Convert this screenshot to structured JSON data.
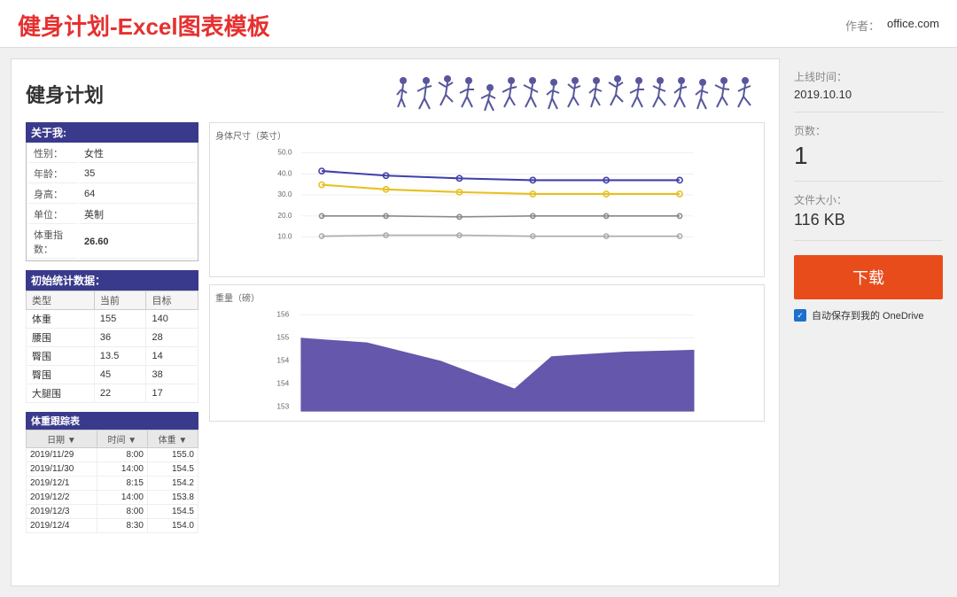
{
  "header": {
    "title": "健身计划-Excel图表模板",
    "author_label": "作者：",
    "author_value": "office.com"
  },
  "sidebar": {
    "online_time_label": "上线时间：",
    "online_time_value": "2019.10.10",
    "pages_label": "页数：",
    "pages_value": "1",
    "filesize_label": "文件大小：",
    "filesize_value": "116 KB",
    "download_label": "下载",
    "onedrive_label": "自动保存到我的 OneDrive"
  },
  "fitness": {
    "title": "健身计划",
    "about_header": "关于我:",
    "about_rows": [
      {
        "label": "性别：",
        "value": "女性"
      },
      {
        "label": "年龄：",
        "value": "35"
      },
      {
        "label": "身高：",
        "value": "64"
      },
      {
        "label": "单位：",
        "value": "英制"
      },
      {
        "label": "体重指数：",
        "value": "26.60",
        "highlight": true
      }
    ],
    "stats_header": "初始统计数据：",
    "stats_cols": [
      "类型",
      "当前",
      "目标"
    ],
    "stats_rows": [
      [
        "体重",
        "155",
        "140"
      ],
      [
        "腰围",
        "36",
        "28"
      ],
      [
        "臀围",
        "13.5",
        "14"
      ],
      [
        "臀围",
        "45",
        "38"
      ],
      [
        "大腿围",
        "22",
        "17"
      ]
    ],
    "tracker_header": "体重跟踪表",
    "tracker_cols": [
      "日期",
      "时间",
      "体重"
    ],
    "tracker_rows": [
      [
        "2019/11/29",
        "8:00",
        "155.0"
      ],
      [
        "2019/11/30",
        "14:00",
        "154.5"
      ],
      [
        "2019/12/1",
        "8:15",
        "154.2"
      ],
      [
        "2019/12/2",
        "14:00",
        "153.8"
      ],
      [
        "2019/12/3",
        "8:00",
        "154.5"
      ],
      [
        "2019/12/4",
        "8:30",
        "154.0"
      ]
    ],
    "line_chart_label": "身体尺寸（英寸）",
    "area_chart_label": "重量（磅）"
  }
}
